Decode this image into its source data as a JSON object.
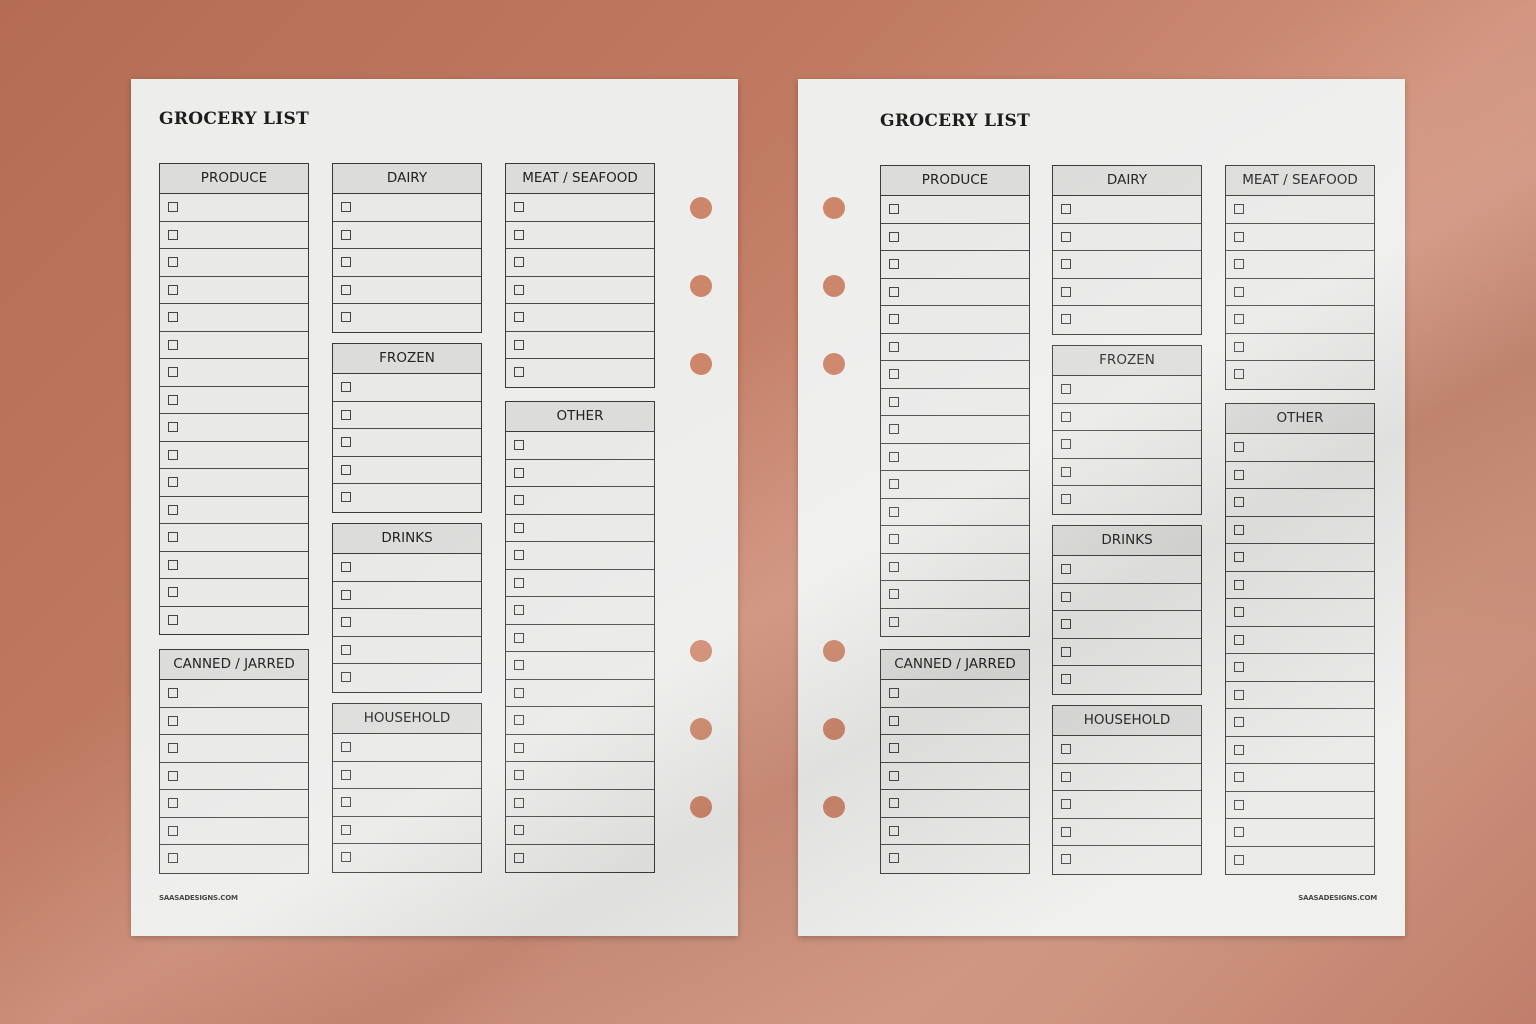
{
  "pages": [
    {
      "title": "GROCERY LIST",
      "footer": "SAASADESIGNS.COM",
      "sections": [
        {
          "label": "PRODUCE",
          "rows": 16
        },
        {
          "label": "CANNED / JARRED",
          "rows": 7
        },
        {
          "label": "DAIRY",
          "rows": 5
        },
        {
          "label": "FROZEN",
          "rows": 5
        },
        {
          "label": "DRINKS",
          "rows": 5
        },
        {
          "label": "HOUSEHOLD",
          "rows": 5
        },
        {
          "label": "MEAT / SEAFOOD",
          "rows": 7
        },
        {
          "label": "OTHER",
          "rows": 16
        }
      ]
    },
    {
      "title": "GROCERY LIST",
      "footer": "SAASADESIGNS.COM",
      "sections": [
        {
          "label": "PRODUCE",
          "rows": 16
        },
        {
          "label": "CANNED / JARRED",
          "rows": 7
        },
        {
          "label": "DAIRY",
          "rows": 5
        },
        {
          "label": "FROZEN",
          "rows": 5
        },
        {
          "label": "DRINKS",
          "rows": 5
        },
        {
          "label": "HOUSEHOLD",
          "rows": 5
        },
        {
          "label": "MEAT / SEAFOOD",
          "rows": 7
        },
        {
          "label": "OTHER",
          "rows": 16
        }
      ]
    }
  ],
  "colors": {
    "background": "#c07a62",
    "paper": "#ededec",
    "hole": "#cc8669",
    "ink": "#2a2a2a"
  }
}
